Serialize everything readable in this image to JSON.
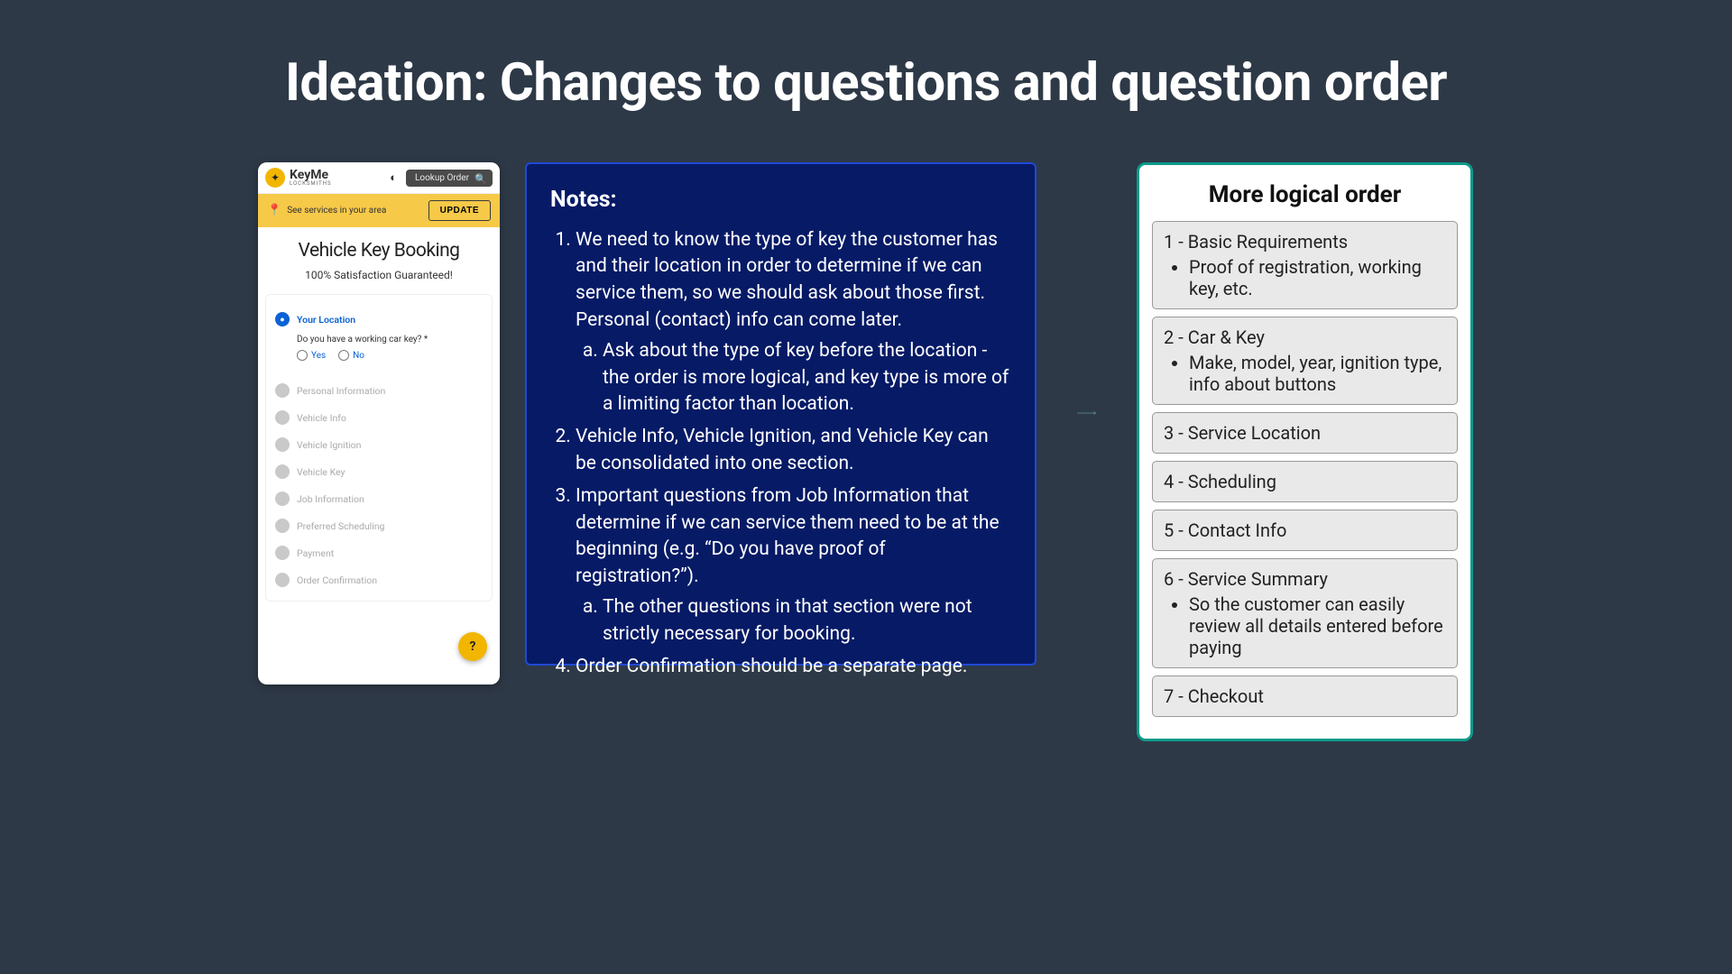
{
  "title": "Ideation: Changes to questions and question order",
  "phone": {
    "logo_name": "KeyMe",
    "logo_sub": "LOCKSMITHS",
    "lookup_label": "Lookup Order",
    "area_text": "See services in your area",
    "update_label": "UPDATE",
    "page_title": "Vehicle Key Booking",
    "page_sub": "100% Satisfaction Guaranteed!",
    "active_step": "Your Location",
    "question": "Do you have a working car key? *",
    "opt_yes": "Yes",
    "opt_no": "No",
    "steps": [
      "Personal Information",
      "Vehicle Info",
      "Vehicle Ignition",
      "Vehicle Key",
      "Job Information",
      "Preferred Scheduling",
      "Payment",
      "Order Confirmation"
    ],
    "help_icon": "?"
  },
  "notes": {
    "heading": "Notes:",
    "n1": "We need to know the type of key the customer has and their location in order to determine if we can service them, so we should ask about those first. Personal (contact) info can come later.",
    "n1a": "Ask about the type of key before the location - the order is more logical, and key type is more of a limiting factor than location.",
    "n2": "Vehicle Info, Vehicle Ignition, and Vehicle Key can be consolidated into one section.",
    "n3": "Important questions from Job Information that determine if we can service them need to be at the beginning (e.g. “Do you have proof of registration?”).",
    "n3a": "The other questions in that section were not strictly necessary for booking.",
    "n4": "Order Confirmation should be a separate page."
  },
  "order": {
    "heading": "More logical order",
    "items": [
      {
        "title": "1 - Basic Requirements",
        "sub": "Proof of registration, working key, etc."
      },
      {
        "title": "2 - Car & Key",
        "sub": "Make, model, year, ignition type, info about buttons"
      },
      {
        "title": "3 - Service Location",
        "sub": ""
      },
      {
        "title": "4 - Scheduling",
        "sub": ""
      },
      {
        "title": "5 - Contact Info",
        "sub": ""
      },
      {
        "title": "6 - Service Summary",
        "sub": "So the customer can easily review all details entered before paying"
      },
      {
        "title": "7 - Checkout",
        "sub": ""
      }
    ]
  }
}
